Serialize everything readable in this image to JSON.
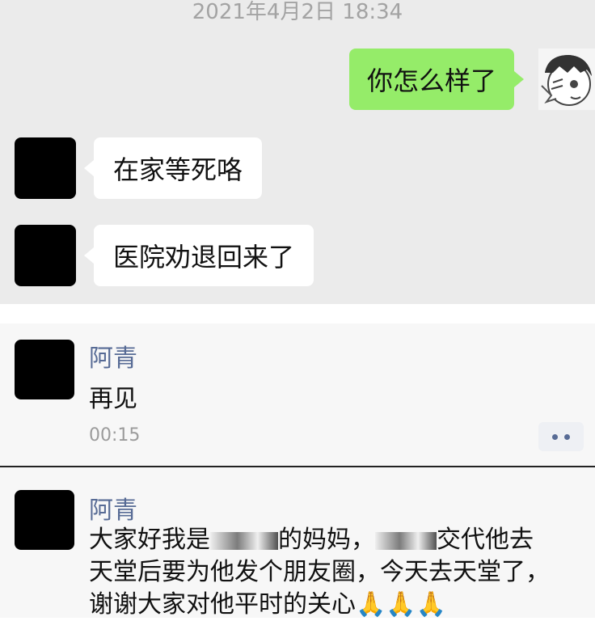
{
  "chat": {
    "timestamp": "2021年4月2日 18:34",
    "messages": [
      {
        "side": "right",
        "text": "你怎么样了"
      },
      {
        "side": "left",
        "text": "在家等死咯"
      },
      {
        "side": "left",
        "text": "医院劝退回来了"
      }
    ]
  },
  "comments": [
    {
      "name": "阿青",
      "text": "再见",
      "time": "00:15"
    },
    {
      "name": "阿青",
      "text_line1_a": "大家好我是",
      "text_line1_b": "的妈妈，",
      "text_line1_c": "交代他去",
      "text_line2": "天堂后要为他发个朋友圈，今天去天堂了，",
      "text_line3": "谢谢大家对他平时的关心",
      "emoji": "🙏🙏🙏"
    }
  ],
  "colors": {
    "chat_bg": "#ebebeb",
    "outgoing_bubble": "#95ec69",
    "incoming_bubble": "#ffffff",
    "name_link": "#576b95"
  }
}
